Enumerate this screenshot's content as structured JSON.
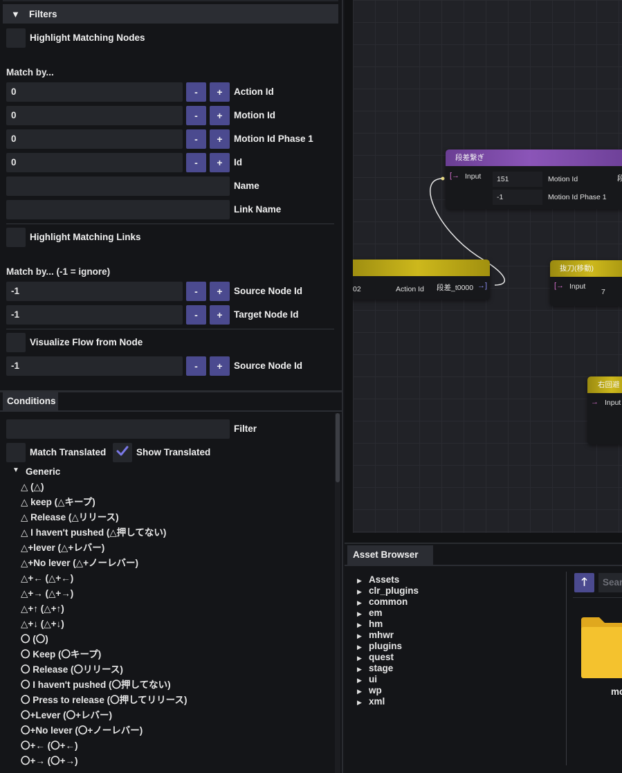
{
  "filters": {
    "title": "Filters",
    "highlight_nodes_label": "Highlight Matching Nodes",
    "match_by_label": "Match by...",
    "node_fields": [
      {
        "value": "0",
        "minus": "-",
        "plus": "+",
        "label": "Action Id"
      },
      {
        "value": "0",
        "minus": "-",
        "plus": "+",
        "label": "Motion Id"
      },
      {
        "value": "0",
        "minus": "-",
        "plus": "+",
        "label": "Motion Id Phase 1"
      },
      {
        "value": "0",
        "minus": "-",
        "plus": "+",
        "label": "Id"
      }
    ],
    "name_label": "Name",
    "link_name_label": "Link Name",
    "highlight_links_label": "Highlight Matching Links",
    "match_by_ignore_label": "Match by... (-1 = ignore)",
    "link_fields": [
      {
        "value": "-1",
        "minus": "-",
        "plus": "+",
        "label": "Source Node Id"
      },
      {
        "value": "-1",
        "minus": "-",
        "plus": "+",
        "label": "Target Node Id"
      }
    ],
    "visualize_flow_label": "Visualize Flow from Node",
    "flow_field": {
      "value": "-1",
      "minus": "-",
      "plus": "+",
      "label": "Source Node Id"
    }
  },
  "conditions": {
    "tab": "Conditions",
    "filter_label": "Filter",
    "match_translated_label": "Match Translated",
    "show_translated_label": "Show Translated",
    "show_translated_checked": true,
    "group": "Generic",
    "items": [
      "△ (△)",
      "△ keep (△キープ)",
      "△ Release (△リリース)",
      "△ I haven't pushed (△押してない)",
      "△+lever (△+レバー)",
      "△+No lever (△+ノーレバー)",
      "△+← (△+←)",
      "△+→ (△+→)",
      "△+↑ (△+↑)",
      "△+↓ (△+↓)",
      "〇 (〇)",
      "〇 Keep (〇キープ)",
      "〇 Release (〇リリース)",
      "〇 I haven't pushed (〇押してない)",
      "〇 Press to release (〇押してリリース)",
      "〇+Lever (〇+レバー)",
      "〇+No lever (〇+ノーレバー)",
      "〇+← (〇+←)",
      "〇+→ (〇+→)"
    ]
  },
  "graph": {
    "node1": {
      "title": "段差繋ぎ",
      "input": "Input",
      "f1_value": "151",
      "f1_label": "Motion Id",
      "f1_extra": "段",
      "f2_value": "-1",
      "f2_label": "Motion Id Phase 1"
    },
    "node2": {
      "value": "02",
      "label": "Action Id",
      "output": "段差_t0000"
    },
    "node3": {
      "title": "抜刀(移動)",
      "input": "Input",
      "value": "7"
    },
    "node4": {
      "title": "右回避",
      "input": "Input"
    }
  },
  "assets": {
    "tab": "Asset Browser",
    "tree": [
      "Assets",
      "clr_plugins",
      "common",
      "em",
      "hm",
      "mhwr",
      "plugins",
      "quest",
      "stage",
      "ui",
      "wp",
      "xml"
    ],
    "search_placeholder": "Search",
    "folder_label": "mc"
  },
  "colors": {
    "accent_button": "#4b4a8f",
    "node_purple": "#8b55b8",
    "node_yellow": "#cdb81c",
    "input_pin": "#d36ecb"
  }
}
